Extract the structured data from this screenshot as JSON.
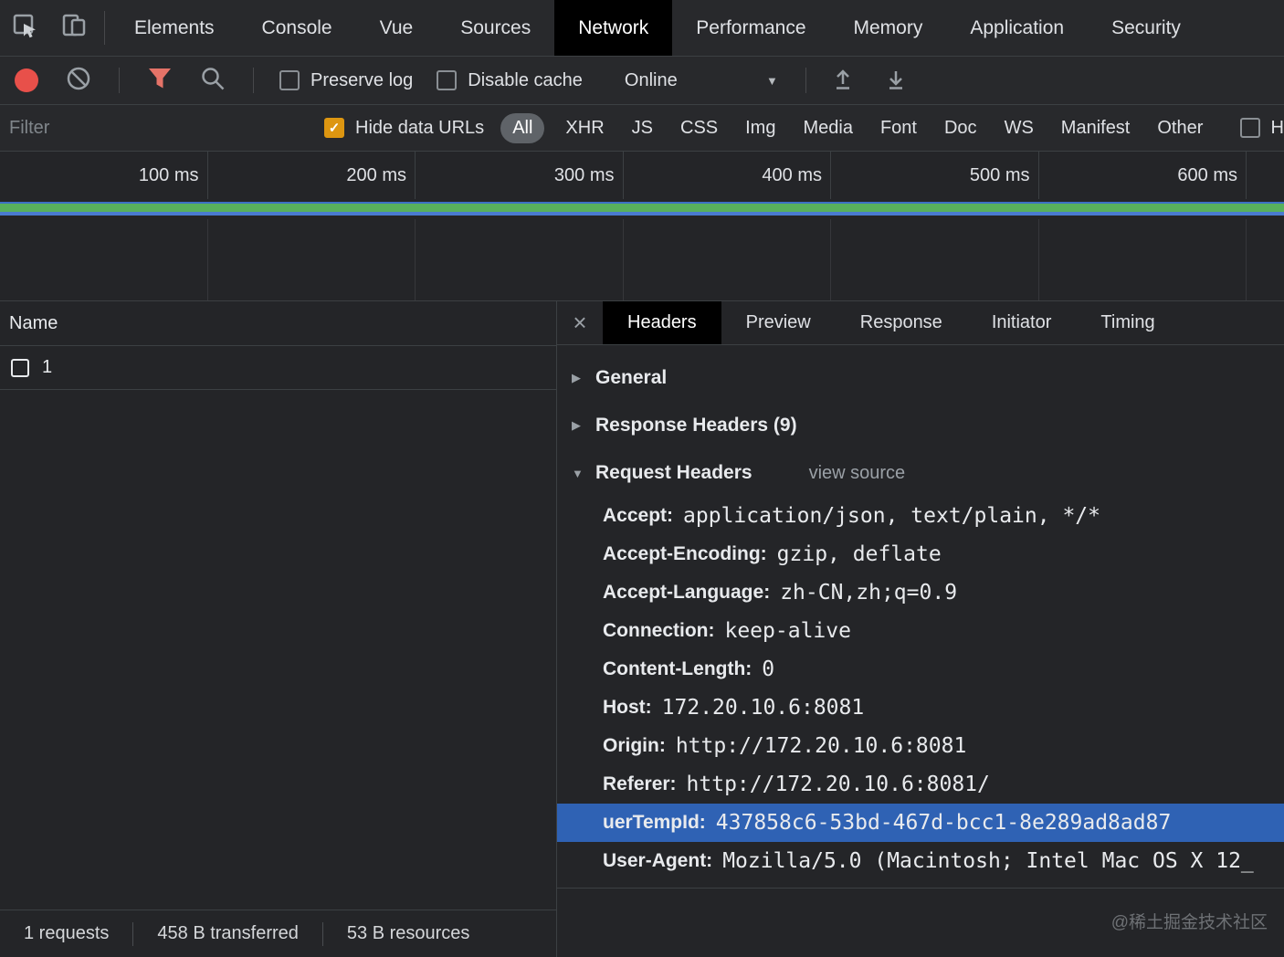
{
  "main_tabs": {
    "items": [
      {
        "label": "Elements",
        "active": false
      },
      {
        "label": "Console",
        "active": false
      },
      {
        "label": "Vue",
        "active": false
      },
      {
        "label": "Sources",
        "active": false
      },
      {
        "label": "Network",
        "active": true
      },
      {
        "label": "Performance",
        "active": false
      },
      {
        "label": "Memory",
        "active": false
      },
      {
        "label": "Application",
        "active": false
      },
      {
        "label": "Security",
        "active": false
      }
    ]
  },
  "toolbar": {
    "preserve_log": {
      "label": "Preserve log",
      "checked": false
    },
    "disable_cache": {
      "label": "Disable cache",
      "checked": false
    },
    "throttling": {
      "value": "Online"
    }
  },
  "filter_bar": {
    "input_placeholder": "Filter",
    "hide_data_urls": {
      "label": "Hide data URLs",
      "checked": true
    },
    "types": [
      {
        "label": "All",
        "active": true
      },
      {
        "label": "XHR",
        "active": false
      },
      {
        "label": "JS",
        "active": false
      },
      {
        "label": "CSS",
        "active": false
      },
      {
        "label": "Img",
        "active": false
      },
      {
        "label": "Media",
        "active": false
      },
      {
        "label": "Font",
        "active": false
      },
      {
        "label": "Doc",
        "active": false
      },
      {
        "label": "WS",
        "active": false
      },
      {
        "label": "Manifest",
        "active": false
      },
      {
        "label": "Other",
        "active": false
      }
    ],
    "clipped_checkbox_label": "H"
  },
  "timeline": {
    "ticks": [
      "100 ms",
      "200 ms",
      "300 ms",
      "400 ms",
      "500 ms",
      "600 ms"
    ]
  },
  "requests_panel": {
    "columns": [
      "Name"
    ],
    "rows": [
      {
        "name": "1"
      }
    ],
    "status_bar": [
      "1 requests",
      "458 B transferred",
      "53 B resources"
    ]
  },
  "details_panel": {
    "tabs": [
      {
        "label": "Headers",
        "active": true
      },
      {
        "label": "Preview",
        "active": false
      },
      {
        "label": "Response",
        "active": false
      },
      {
        "label": "Initiator",
        "active": false
      },
      {
        "label": "Timing",
        "active": false
      }
    ],
    "sections": [
      {
        "title": "General",
        "expanded": false
      },
      {
        "title": "Response Headers (9)",
        "expanded": false
      },
      {
        "title": "Request Headers",
        "expanded": true,
        "action": "view source"
      }
    ],
    "request_headers": [
      {
        "name": "Accept:",
        "value": "application/json, text/plain, */*",
        "highlighted": false
      },
      {
        "name": "Accept-Encoding:",
        "value": "gzip, deflate",
        "highlighted": false
      },
      {
        "name": "Accept-Language:",
        "value": "zh-CN,zh;q=0.9",
        "highlighted": false
      },
      {
        "name": "Connection:",
        "value": "keep-alive",
        "highlighted": false
      },
      {
        "name": "Content-Length:",
        "value": "0",
        "highlighted": false
      },
      {
        "name": "Host:",
        "value": "172.20.10.6:8081",
        "highlighted": false
      },
      {
        "name": "Origin:",
        "value": "http://172.20.10.6:8081",
        "highlighted": false
      },
      {
        "name": "Referer:",
        "value": "http://172.20.10.6:8081/",
        "highlighted": false
      },
      {
        "name": "uerTempId:",
        "value": "437858c6-53bd-467d-bcc1-8e289ad8ad87",
        "highlighted": true
      },
      {
        "name": "User-Agent:",
        "value": "Mozilla/5.0 (Macintosh; Intel Mac OS X 12_",
        "highlighted": false
      }
    ]
  },
  "watermark": "@稀土掘金技术社区",
  "glyphs": {
    "close": "×",
    "collapsed_arrow": "▶",
    "expanded_arrow": "▼",
    "dropdown_arrow": "▼",
    "check": "✓"
  },
  "colors": {
    "selection_blue": "#2f62b4",
    "active_tab_black": "#000000",
    "record_red": "#e8504a",
    "filter_funnel_red": "#e57368",
    "checkbox_checked_orange": "#dd9611",
    "overview_green": "#58b05c",
    "overview_blue": "#4a7bd0"
  }
}
